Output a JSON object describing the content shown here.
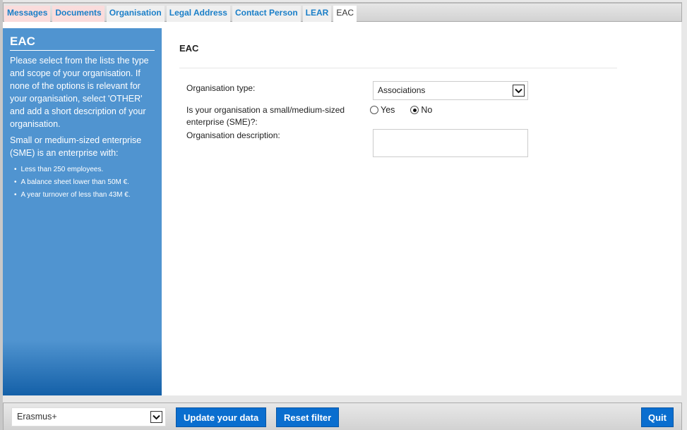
{
  "tabs": [
    {
      "label": "Messages",
      "state": "highlighted"
    },
    {
      "label": "Documents",
      "state": "highlighted"
    },
    {
      "label": "Organisation",
      "state": "normal"
    },
    {
      "label": "Legal Address",
      "state": "normal"
    },
    {
      "label": "Contact Person",
      "state": "normal"
    },
    {
      "label": "LEAR",
      "state": "normal"
    },
    {
      "label": "EAC",
      "state": "active"
    }
  ],
  "sidebar": {
    "title": "EAC",
    "intro": "Please select from the lists the type and scope of your organisation. If none of the options is relevant for your organisation, select 'OTHER' and add a short description of your organisation.",
    "sme_intro": "Small or medium-sized enterprise (SME) is an enterprise with:",
    "criteria": [
      "Less than 250 employees.",
      "A balance sheet lower than 50M €.",
      "A year turnover of less than 43M €."
    ]
  },
  "main": {
    "title": "EAC",
    "org_type_label": "Organisation type:",
    "org_type_value": "Associations",
    "sme_label": "Is your organisation a small/medium-sized enterprise (SME)?:",
    "sme_options": [
      {
        "label": "Yes",
        "selected": false
      },
      {
        "label": "No",
        "selected": true
      }
    ],
    "description_label": "Organisation description:",
    "description_value": ""
  },
  "footer": {
    "programme_value": "Erasmus+",
    "update_label": "Update your data",
    "reset_label": "Reset filter",
    "quit_label": "Quit"
  },
  "colors": {
    "accent": "#0a6ecf",
    "sidebar": "#5094d0",
    "tab_link": "#1a7fc8",
    "tab_highlight": "#fadcdc"
  }
}
